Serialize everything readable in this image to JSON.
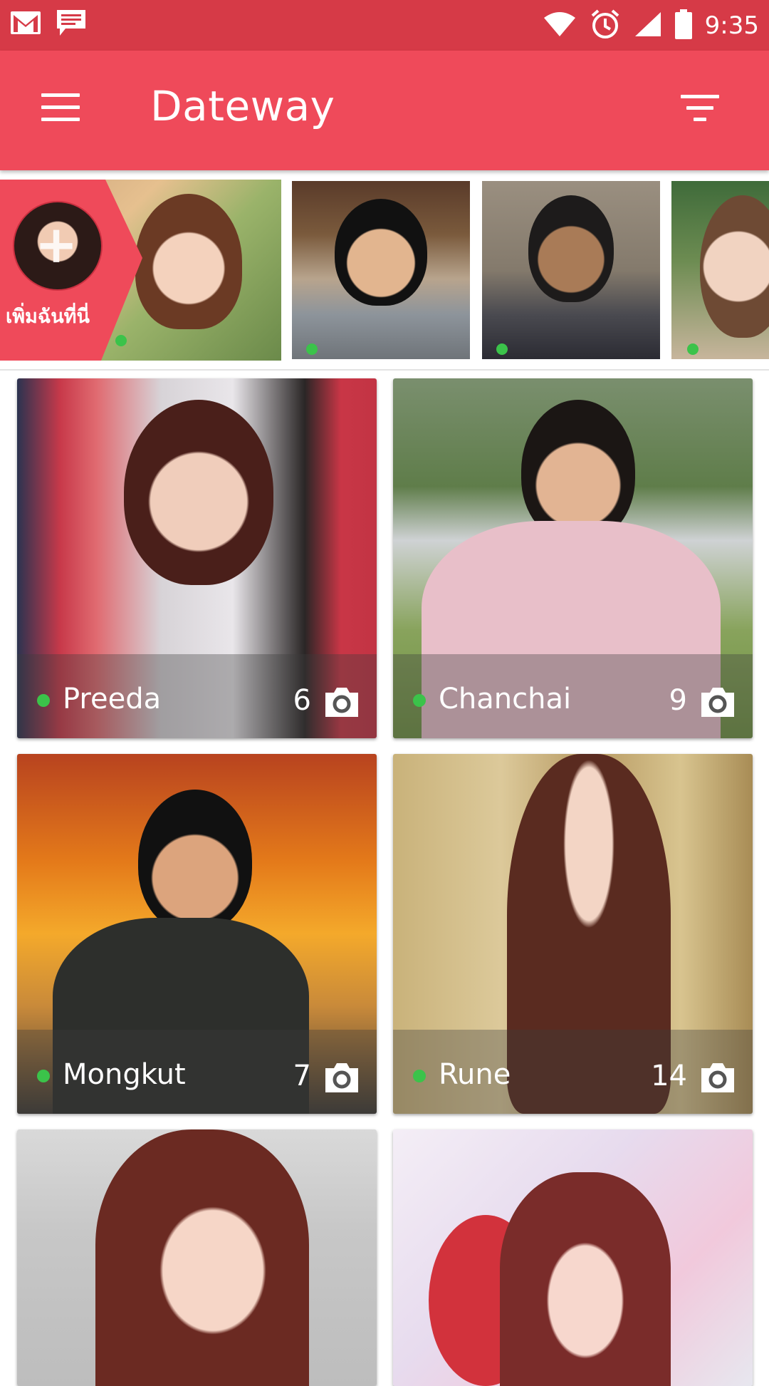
{
  "status_bar": {
    "time": "9:35",
    "icons": [
      "gmail-icon",
      "chat-icon",
      "wifi-icon",
      "alarm-icon",
      "signal-icon",
      "battery-icon"
    ]
  },
  "app_bar": {
    "title": "Dateway",
    "menu_icon": "hamburger-menu-icon",
    "filter_icon": "filter-icon"
  },
  "stories": {
    "add_label": "เพิ่มฉันที่นี่",
    "items": [
      {
        "name": "story-1",
        "online": true
      },
      {
        "name": "story-2",
        "online": true
      },
      {
        "name": "story-3",
        "online": true
      },
      {
        "name": "story-4",
        "online": true
      },
      {
        "name": "story-5",
        "online": true
      }
    ]
  },
  "profiles": [
    {
      "name": "Preeda",
      "photos": "6",
      "online": true
    },
    {
      "name": "Chanchai",
      "photos": "9",
      "online": true
    },
    {
      "name": "Mongkut",
      "photos": "7",
      "online": true
    },
    {
      "name": "Rune",
      "photos": "14",
      "online": true
    },
    {
      "name": "",
      "photos": "",
      "online": false
    },
    {
      "name": "",
      "photos": "",
      "online": false
    }
  ],
  "colors": {
    "status_bar": "#d63a47",
    "app_bar": "#ef4a5a",
    "online": "#3bc34a"
  }
}
